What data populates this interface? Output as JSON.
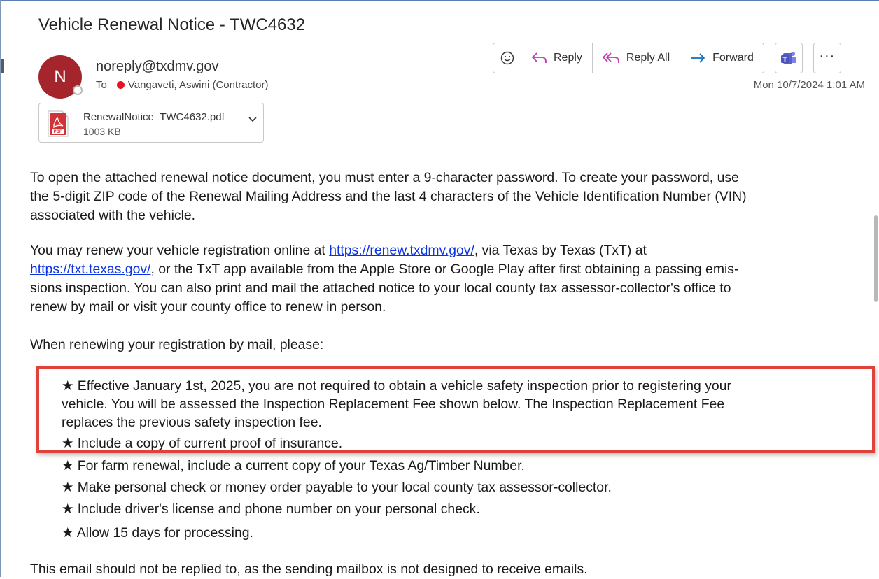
{
  "email": {
    "subject": "Vehicle Renewal Notice - TWC4632",
    "avatar_initial": "N",
    "sender": "noreply@txdmv.gov",
    "to_label": "To",
    "recipient": "Vangaveti, Aswini (Contractor)",
    "timestamp": "Mon 10/7/2024 1:01 AM"
  },
  "toolbar": {
    "reply_label": "Reply",
    "reply_all_label": "Reply All",
    "forward_label": "Forward"
  },
  "attachment": {
    "filename": "RenewalNotice_TWC4632.pdf",
    "size": "1003 KB",
    "type_label": "PDF"
  },
  "body": {
    "p1_lines": [
      "To open the attached renewal notice document, you must enter a 9-character password. To create your password, use",
      "the 5-digit ZIP code of the Renewal Mailing Address and the last 4 characters of the Vehicle Identification Number (VIN)",
      "associated with the vehicle."
    ],
    "p2_line1_pre": "You may renew your vehicle registration online at ",
    "link1": "https://renew.txdmv.gov/",
    "p2_line1_post": ", via Texas by Texas (TxT) at",
    "link2": "https://txt.texas.gov/",
    "p2_line2_post": ", or the TxT app available from the Apple Store or Google Play after first obtaining a passing emis-",
    "p2_line3": "sions inspection. You can also print and mail the attached notice to your local county tax assessor-collector's office to",
    "p2_line4": "renew by mail or visit your county office to renew in person.",
    "p3": "When renewing your registration by mail, please:",
    "bullets": [
      "★ Effective January 1st, 2025, you are not required to obtain a vehicle safety inspection prior to registering your",
      "vehicle. You will be assessed the Inspection Replacement Fee shown below. The Inspection Replacement Fee",
      "replaces the previous safety inspection fee.",
      "★ Include a copy of current proof of insurance.",
      "★ For farm renewal, include a current copy of your Texas Ag/Timber Number.",
      "★ Make personal check or money order payable to your local county tax assessor-collector.",
      "★ Include driver's license and phone number on your personal check.",
      "★ Allow 15 days for processing."
    ],
    "footer": "This email should not be replied to, as the sending mailbox is not designed to receive emails."
  },
  "colors": {
    "avatar": "#a4262c",
    "link": "#0b33e6",
    "highlight_border": "#e0413b",
    "reply_icon": "#c239b3",
    "forward_icon": "#0f6cbd",
    "teams": "#5b5fc7"
  }
}
